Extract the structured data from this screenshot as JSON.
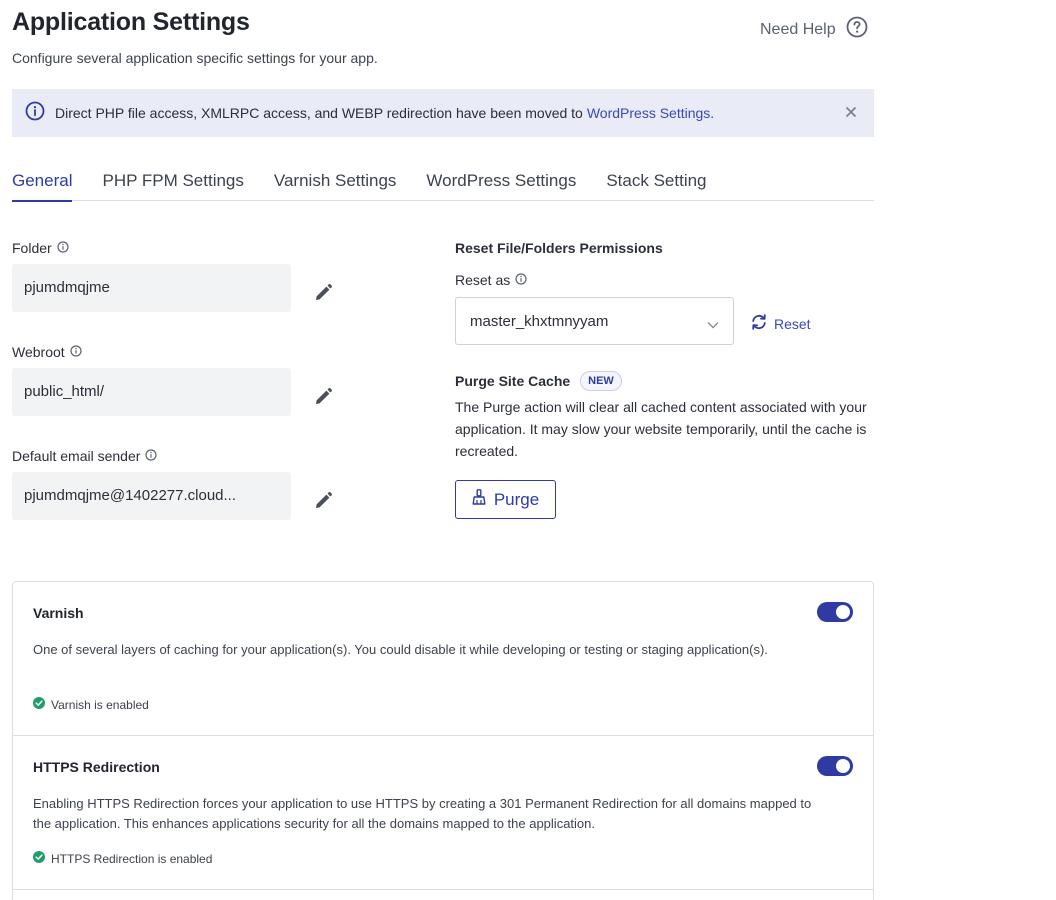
{
  "header": {
    "title": "Application Settings",
    "subtitle": "Configure several application specific settings for your app.",
    "help_label": "Need Help"
  },
  "notice": {
    "text": "Direct PHP file access, XMLRPC access, and WEBP redirection have been moved to",
    "link": "WordPress Settings."
  },
  "tabs": [
    {
      "label": "General",
      "active": true
    },
    {
      "label": "PHP FPM Settings"
    },
    {
      "label": "Varnish Settings"
    },
    {
      "label": "WordPress Settings"
    },
    {
      "label": "Stack Setting"
    }
  ],
  "fields": {
    "folder": {
      "label": "Folder",
      "value": "pjumdmqjme"
    },
    "webroot": {
      "label": "Webroot",
      "value": "public_html/"
    },
    "email": {
      "label": "Default email sender",
      "value": "pjumdmqjme@1402277.cloud..."
    }
  },
  "permissions": {
    "heading": "Reset File/Folders Permissions",
    "reset_as_label": "Reset as",
    "selected_user": "master_khxtmnyyam",
    "reset_label": "Reset"
  },
  "purge": {
    "heading": "Purge Site Cache",
    "badge": "NEW",
    "description": "The Purge action will clear all cached content associated with your application. It may slow your website temporarily, until the cache is recreated.",
    "button_label": "Purge"
  },
  "cards": [
    {
      "title": "Varnish",
      "description": "One of several layers of caching for your application(s). You could disable it while developing or testing or staging application(s).",
      "status": "Varnish is enabled",
      "enabled": true
    },
    {
      "title": "HTTPS Redirection",
      "description": "Enabling HTTPS Redirection forces your application to use HTTPS by creating a 301 Permanent Redirection for all domains mapped to the application. This enhances applications security for all the domains mapped to the application.",
      "status": "HTTPS Redirection is enabled",
      "enabled": true
    }
  ],
  "colors": {
    "accent": "#2f3aa3",
    "notice_bg": "#e9ebf7",
    "success": "#1f9d6b"
  }
}
